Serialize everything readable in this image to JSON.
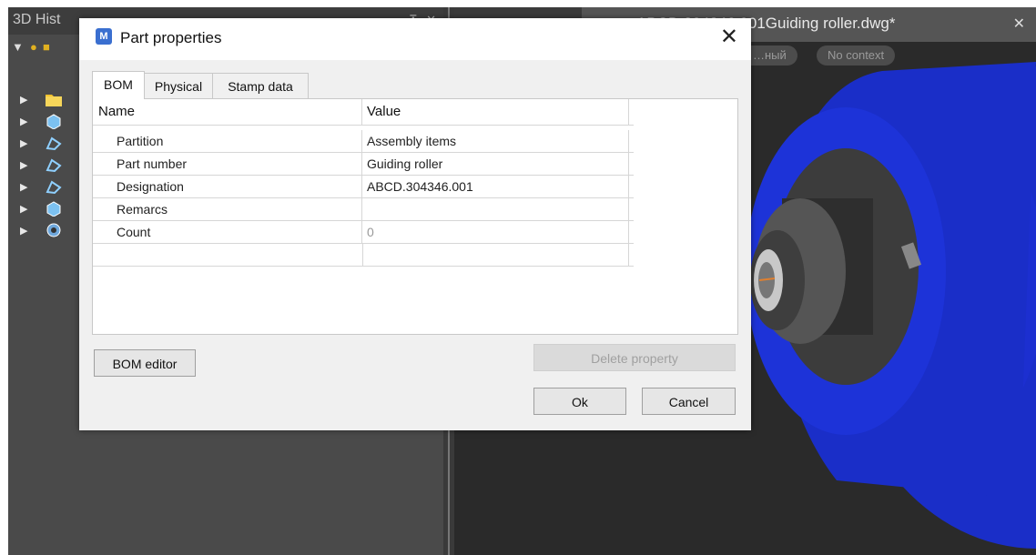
{
  "left_panel": {
    "title": "3D Hist",
    "pin_controls": "⊼ ✕"
  },
  "document_tab": {
    "title": "ABCD.304346.001Guiding roller.dwg*",
    "close": "✕"
  },
  "context_pills": [
    "…ный",
    "No context"
  ],
  "dialog": {
    "icon_letter": "M",
    "title": "Part properties",
    "close": "✕",
    "tabs": [
      "BOM",
      "Physical",
      "Stamp data"
    ],
    "table": {
      "headers": [
        "Name",
        "Value"
      ],
      "rows": [
        {
          "name": "Partition",
          "value": "Assembly items"
        },
        {
          "name": "Part number",
          "value": "Guiding roller"
        },
        {
          "name": "Designation",
          "value": "ABCD.304346.001"
        },
        {
          "name": "Remarcs",
          "value": ""
        },
        {
          "name": "Count",
          "value": "0"
        },
        {
          "name": "",
          "value": ""
        }
      ]
    },
    "buttons": {
      "bom_editor": "BOM editor",
      "delete_property": "Delete property",
      "ok": "Ok",
      "cancel": "Cancel"
    }
  },
  "colors": {
    "model_blue": "#1a2ec8",
    "dialog_bg": "#f0f0f0",
    "panel_bg": "#4a4a4a"
  }
}
